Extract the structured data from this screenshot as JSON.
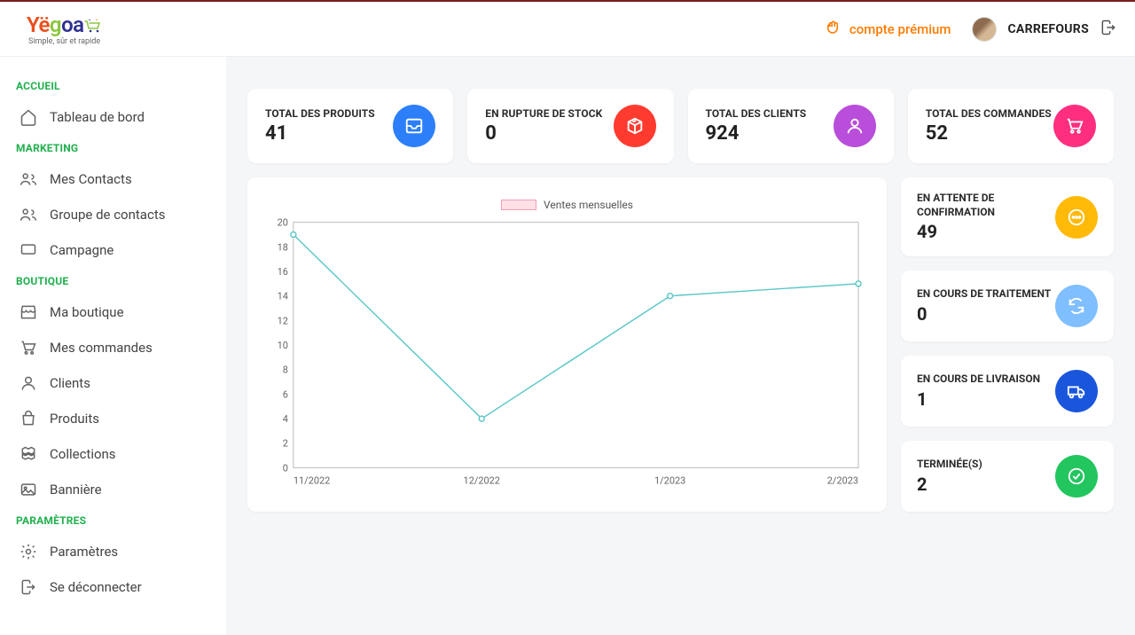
{
  "logo": {
    "tagline": "Simple, sûr et rapide"
  },
  "header": {
    "premium_label": "compte prémium",
    "user_name": "CARREFOURS"
  },
  "sidebar": {
    "sections": [
      {
        "label": "ACCUEIL",
        "items": [
          {
            "label": "Tableau de bord",
            "icon": "home"
          }
        ]
      },
      {
        "label": "MARKETING",
        "items": [
          {
            "label": "Mes Contacts",
            "icon": "users"
          },
          {
            "label": "Groupe de contacts",
            "icon": "users"
          },
          {
            "label": "Campagne",
            "icon": "chat"
          }
        ]
      },
      {
        "label": "BOUTIQUE",
        "items": [
          {
            "label": "Ma boutique",
            "icon": "store"
          },
          {
            "label": "Mes commandes",
            "icon": "cart"
          },
          {
            "label": "Clients",
            "icon": "person"
          },
          {
            "label": "Produits",
            "icon": "bag"
          },
          {
            "label": "Collections",
            "icon": "boxes"
          },
          {
            "label": "Bannière",
            "icon": "image"
          }
        ]
      },
      {
        "label": "PARAMÈTRES",
        "items": [
          {
            "label": "Paramètres",
            "icon": "gear"
          },
          {
            "label": "Se déconnecter",
            "icon": "logout"
          }
        ]
      }
    ]
  },
  "stats": {
    "total_products": {
      "label": "TOTAL DES PRODUITS",
      "value": "41"
    },
    "out_of_stock": {
      "label": "EN RUPTURE DE STOCK",
      "value": "0"
    },
    "total_clients": {
      "label": "TOTAL DES CLIENTS",
      "value": "924"
    },
    "total_orders": {
      "label": "TOTAL DES COMMANDES",
      "value": "52"
    }
  },
  "order_status": {
    "awaiting": {
      "label": "EN ATTENTE DE CONFIRMATION",
      "value": "49"
    },
    "processing": {
      "label": "EN COURS DE TRAITEMENT",
      "value": "0"
    },
    "shipping": {
      "label": "EN COURS DE LIVRAISON",
      "value": "1"
    },
    "completed": {
      "label": "TERMINÉE(S)",
      "value": "2"
    }
  },
  "chart_data": {
    "type": "line",
    "title": "",
    "legend": "Ventes mensuelles",
    "xlabel": "",
    "ylabel": "",
    "ylim": [
      0,
      20
    ],
    "yticks": [
      0,
      2,
      4,
      6,
      8,
      10,
      12,
      14,
      16,
      18,
      20
    ],
    "categories": [
      "11/2022",
      "12/2022",
      "1/2023",
      "2/2023"
    ],
    "series": [
      {
        "name": "Ventes mensuelles",
        "values": [
          19,
          4,
          14,
          15
        ]
      }
    ],
    "colors": {
      "line": "#5fc8c8"
    }
  }
}
